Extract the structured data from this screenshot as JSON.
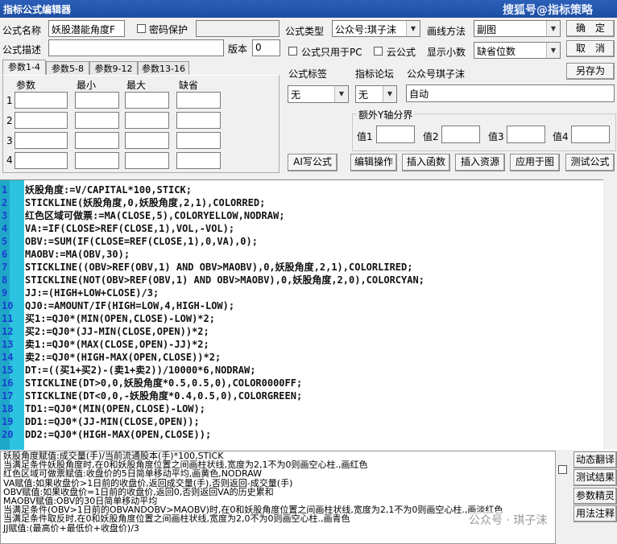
{
  "window": {
    "title": "指标公式编辑器",
    "watermark": "搜狐号@指标策略"
  },
  "form": {
    "name_label": "公式名称",
    "name_value": "妖股潜能角度F",
    "password_label": "密码保护",
    "desc_label": "公式描述",
    "version_label": "版本",
    "version_value": "0",
    "type_label": "公式类型",
    "type_value": "公众号:琪子沫",
    "draw_label": "画线方法",
    "draw_value": "副图",
    "pc_only_label": "公式只用于PC",
    "cloud_label": "云公式",
    "decimals_label": "显示小数",
    "decimals_value": "缺省位数",
    "tag_label": "公式标签",
    "tag_value": "无",
    "forum_label": "指标论坛",
    "forum_value": "无",
    "account_label": "公众号琪子沫",
    "account_value": "自动",
    "yaxis_label": "额外Y轴分界",
    "yvals": [
      "值1",
      "值2",
      "值3",
      "值4"
    ]
  },
  "buttons": {
    "ok": "确　定",
    "cancel": "取　消",
    "saveas": "另存为",
    "ai": "AI写公式",
    "edit": "编辑操作",
    "insert_func": "插入函数",
    "insert_res": "插入资源",
    "apply": "应用于图",
    "test": "测试公式",
    "translate": "动态翻译",
    "test_result": "测试结果",
    "param_tune": "参数精灵",
    "usage": "用法注释"
  },
  "params": {
    "tabs": [
      "参数1-4",
      "参数5-8",
      "参数9-12",
      "参数13-16"
    ],
    "headers": [
      "参数",
      "最小",
      "最大",
      "缺省"
    ],
    "rows": [
      "1",
      "2",
      "3",
      "4"
    ]
  },
  "code_lines": [
    "妖股角度:=V/CAPITAL*100,STICK;",
    "STICKLINE(妖股角度,0,妖股角度,2,1),COLORRED;",
    "红色区域可做票:=MA(CLOSE,5),COLORYELLOW,NODRAW;",
    "VA:=IF(CLOSE>REF(CLOSE,1),VOL,-VOL);",
    "OBV:=SUM(IF(CLOSE=REF(CLOSE,1),0,VA),0);",
    "MAOBV:=MA(OBV,30);",
    "STICKLINE((OBV>REF(OBV,1) AND OBV>MAOBV),0,妖股角度,2,1),COLORLIRED;",
    "STICKLINE(NOT(OBV>REF(OBV,1) AND OBV>MAOBV),0,妖股角度,2,0),COLORCYAN;",
    "JJ:=(HIGH+LOW+CLOSE)/3;",
    "QJ0:=AMOUNT/IF(HIGH=LOW,4,HIGH-LOW);",
    "买1:=QJ0*(MIN(OPEN,CLOSE)-LOW)*2;",
    "买2:=QJ0*(JJ-MIN(CLOSE,OPEN))*2;",
    "卖1:=QJ0*(MAX(CLOSE,OPEN)-JJ)*2;",
    "卖2:=QJ0*(HIGH-MAX(OPEN,CLOSE))*2;",
    "DT:=((买1+买2)-(卖1+卖2))/10000*6,NODRAW;",
    "STICKLINE(DT>0,0,妖股角度*0.5,0.5,0),COLOR0000FF;",
    "STICKLINE(DT<0,0,-妖股角度*0.4,0.5,0),COLORGREEN;",
    "TD1:=QJ0*(MIN(OPEN,CLOSE)-LOW);",
    "DD1:=QJ0*(JJ-MIN(CLOSE,OPEN));",
    "DD2:=QJ0*(HIGH-MAX(OPEN,CLOSE));"
  ],
  "description_lines": [
    "妖股角度赋值:成交量(手)/当前流通股本(手)*100,STICK",
    "当满足条件妖股角度时,在0和妖股角度位置之间画柱状线,宽度为2,1不为0则画空心柱.,画红色",
    "红色区域可做票赋值:收盘价的5日简单移动平均,画黄色,NODRAW",
    "VA赋值:如果收盘价>1日前的收盘价,返回成交量(手),否则返回-成交量(手)",
    "OBV赋值:如果收盘价=1日前的收盘价,返回0,否则返回VA的历史累和",
    "MAOBV赋值:OBV的30日简单移动平均",
    "当满足条件(OBV>1日前的OBVANDOBV>MAOBV)时,在0和妖股角度位置之间画柱状线,宽度为2,1不为0则画空心柱.,画淡红色",
    "当满足条件取反时,在0和妖股角度位置之间画柱状线,宽度为2,0不为0则画空心柱.,画青色",
    "JJ赋值:(最高价+最低价+收盘价)/3"
  ],
  "footer_watermark": "公众号 · 琪子沫",
  "colors": {
    "title_bar": "#1d4ea3",
    "gutter": "#1fa7c8",
    "line_num": "#1a3fd0"
  }
}
